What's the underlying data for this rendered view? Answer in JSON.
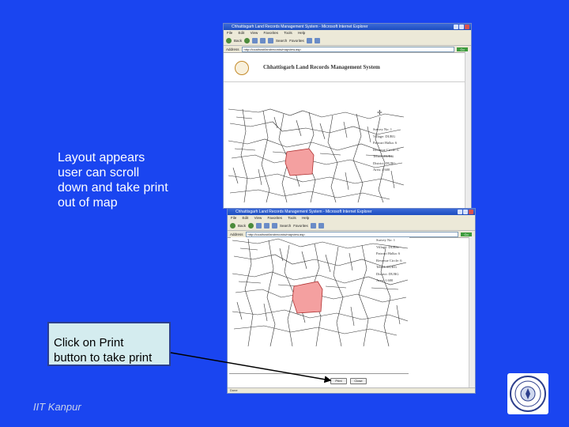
{
  "caption": {
    "lines": [
      "Layout appears",
      "user can scroll",
      "down and take print",
      "out of map"
    ]
  },
  "callout": {
    "lines": [
      "Click on Print",
      "button to take print"
    ]
  },
  "footer": {
    "text": "IIT Kanpur"
  },
  "browser": {
    "title": "Chhattisgarh Land Records Management System - Microsoft Internet Explorer",
    "menu": [
      "File",
      "Edit",
      "View",
      "Favorites",
      "Tools",
      "Help"
    ],
    "toolbar": {
      "back": "Back",
      "search": "Search",
      "favorites": "Favorites"
    },
    "address_label": "Address",
    "address_value": "http://localhost/landrecords/mapview.asp",
    "go": "Go",
    "app_title": "Chhattisgarh Land Records Management System",
    "status": "Done"
  },
  "legend": [
    "Survey No: 1",
    "Village: DURG",
    "Patwari Halka: 6",
    "Revenue Circle: 6",
    "Tehsil: DURG",
    "District: DURG",
    "Area: 1.600"
  ],
  "print_buttons": {
    "print": "Print",
    "close": "Close"
  },
  "colors": {
    "slide_bg": "#1a45f0",
    "highlight_plot": "#f4a0a0",
    "callout_bg": "#d4ecef"
  }
}
